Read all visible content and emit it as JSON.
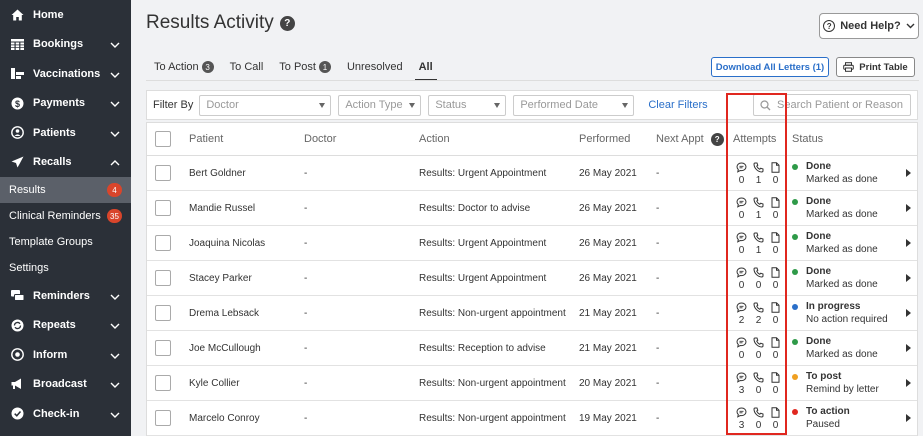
{
  "sidebar": {
    "items": [
      {
        "label": "Home",
        "icon": "home-icon",
        "chevron": false
      },
      {
        "label": "Bookings",
        "icon": "calendar-grid-icon",
        "chevron": true
      },
      {
        "label": "Vaccinations",
        "icon": "vaccine-icon",
        "chevron": true
      },
      {
        "label": "Payments",
        "icon": "dollar-icon",
        "chevron": true
      },
      {
        "label": "Patients",
        "icon": "person-circle-icon",
        "chevron": true
      },
      {
        "label": "Recalls",
        "icon": "paper-plane-icon",
        "chevron": true,
        "expanded": true
      }
    ],
    "recall_sub": [
      {
        "label": "Results",
        "badge": "4",
        "active": true
      },
      {
        "label": "Clinical Reminders",
        "badge": "35",
        "active": false
      },
      {
        "label": "Template Groups",
        "badge": "",
        "active": false
      },
      {
        "label": "Settings",
        "badge": "",
        "active": false
      }
    ],
    "items_after": [
      {
        "label": "Reminders",
        "icon": "chat-bubbles-icon",
        "chevron": true
      },
      {
        "label": "Repeats",
        "icon": "repeat-icon",
        "chevron": true
      },
      {
        "label": "Inform",
        "icon": "inform-icon",
        "chevron": true
      },
      {
        "label": "Broadcast",
        "icon": "megaphone-icon",
        "chevron": true
      },
      {
        "label": "Check-in",
        "icon": "check-circle-icon",
        "chevron": true
      }
    ]
  },
  "header": {
    "title": "Results Activity",
    "help_button": "Need Help?"
  },
  "tabs": [
    {
      "label": "To Action",
      "count": "3",
      "active": false
    },
    {
      "label": "To Call",
      "count": "",
      "active": false
    },
    {
      "label": "To Post",
      "count": "1",
      "active": false
    },
    {
      "label": "Unresolved",
      "count": "",
      "active": false
    },
    {
      "label": "All",
      "count": "",
      "active": true
    }
  ],
  "actions": {
    "download": "Download All Letters (1)",
    "print": "Print Table"
  },
  "filters": {
    "label": "Filter By",
    "doctor": "Doctor",
    "action_type": "Action Type",
    "status": "Status",
    "performed_date": "Performed Date",
    "clear": "Clear Filters",
    "search_placeholder": "Search Patient or Reason"
  },
  "table": {
    "columns": [
      "Patient",
      "Doctor",
      "Action",
      "Performed",
      "Next Appt",
      "Attempts",
      "Status"
    ],
    "rows": [
      {
        "patient": "Bert Goldner",
        "doctor": "-",
        "action": "Results: Urgent Appointment",
        "performed": "26 May 2021",
        "next": "-",
        "att": [
          "0",
          "1",
          "0"
        ],
        "status": "Done",
        "status_sub": "Marked as done",
        "status_color": "#2e9a48"
      },
      {
        "patient": "Mandie Russel",
        "doctor": "-",
        "action": "Results: Doctor to advise",
        "performed": "26 May 2021",
        "next": "-",
        "att": [
          "0",
          "1",
          "0"
        ],
        "status": "Done",
        "status_sub": "Marked as done",
        "status_color": "#2e9a48"
      },
      {
        "patient": "Joaquina Nicolas",
        "doctor": "-",
        "action": "Results: Urgent Appointment",
        "performed": "26 May 2021",
        "next": "-",
        "att": [
          "0",
          "1",
          "0"
        ],
        "status": "Done",
        "status_sub": "Marked as done",
        "status_color": "#2e9a48"
      },
      {
        "patient": "Stacey Parker",
        "doctor": "-",
        "action": "Results: Urgent Appointment",
        "performed": "26 May 2021",
        "next": "-",
        "att": [
          "0",
          "0",
          "0"
        ],
        "status": "Done",
        "status_sub": "Marked as done",
        "status_color": "#2e9a48"
      },
      {
        "patient": "Drema Lebsack",
        "doctor": "-",
        "action": "Results: Non-urgent appointment",
        "performed": "21 May 2021",
        "next": "-",
        "att": [
          "2",
          "2",
          "0"
        ],
        "status": "In progress",
        "status_sub": "No action required",
        "status_color": "#2a6fc9"
      },
      {
        "patient": "Joe McCullough",
        "doctor": "-",
        "action": "Results: Reception to advise",
        "performed": "21 May 2021",
        "next": "-",
        "att": [
          "0",
          "0",
          "0"
        ],
        "status": "Done",
        "status_sub": "Marked as done",
        "status_color": "#2e9a48"
      },
      {
        "patient": "Kyle Collier",
        "doctor": "-",
        "action": "Results: Non-urgent appointment",
        "performed": "20 May 2021",
        "next": "-",
        "att": [
          "3",
          "0",
          "0"
        ],
        "status": "To post",
        "status_sub": "Remind by letter",
        "status_color": "#f0a020"
      },
      {
        "patient": "Marcelo Conroy",
        "doctor": "-",
        "action": "Results: Non-urgent appointment",
        "performed": "19 May 2021",
        "next": "-",
        "att": [
          "3",
          "0",
          "0"
        ],
        "status": "To action",
        "status_sub": "Paused",
        "status_color": "#e0271f"
      }
    ]
  },
  "colors": {
    "sidebar_bg": "#2b3038",
    "active_sub_bg": "#5b6069",
    "accent_blue": "#2a6fc9",
    "highlight_red": "#e0271f"
  }
}
